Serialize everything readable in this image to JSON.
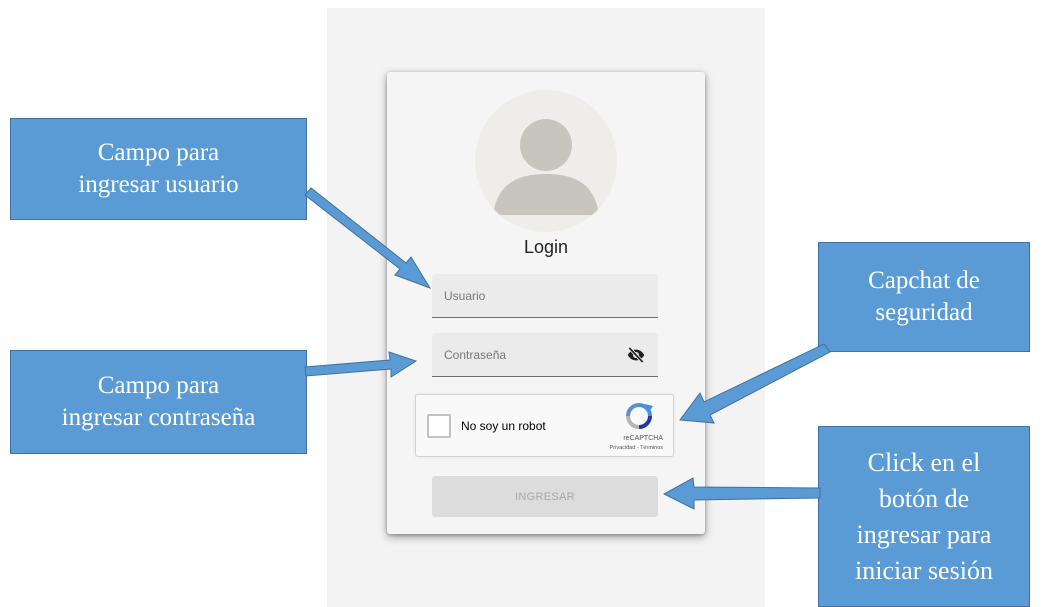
{
  "login": {
    "title": "Login",
    "username_placeholder": "Usuario",
    "password_placeholder": "Contraseña",
    "submit_label": "INGRESAR"
  },
  "captcha": {
    "label": "No soy un robot",
    "brand": "reCAPTCHA",
    "links": "Privacidad - Términos"
  },
  "icons": {
    "avatar": "person-avatar-icon",
    "password_toggle": "eye-off-icon",
    "captcha_logo": "recaptcha-logo-icon"
  },
  "annotations": {
    "user_field": {
      "line1": "Campo para",
      "line2": "ingresar usuario"
    },
    "password_field": {
      "line1": "Campo para",
      "line2": "ingresar contraseña"
    },
    "captcha": {
      "line1": "Capchat de",
      "line2": "seguridad"
    },
    "submit": {
      "line1": "Click en el",
      "line2": "botón de",
      "line3": "ingresar para",
      "line4": "iniciar sesión"
    }
  },
  "colors": {
    "callout_fill": "#5b9bd5",
    "callout_border": "#41719c",
    "arrow": "#5b9bd5",
    "button_disabled": "#dcdcdc"
  }
}
